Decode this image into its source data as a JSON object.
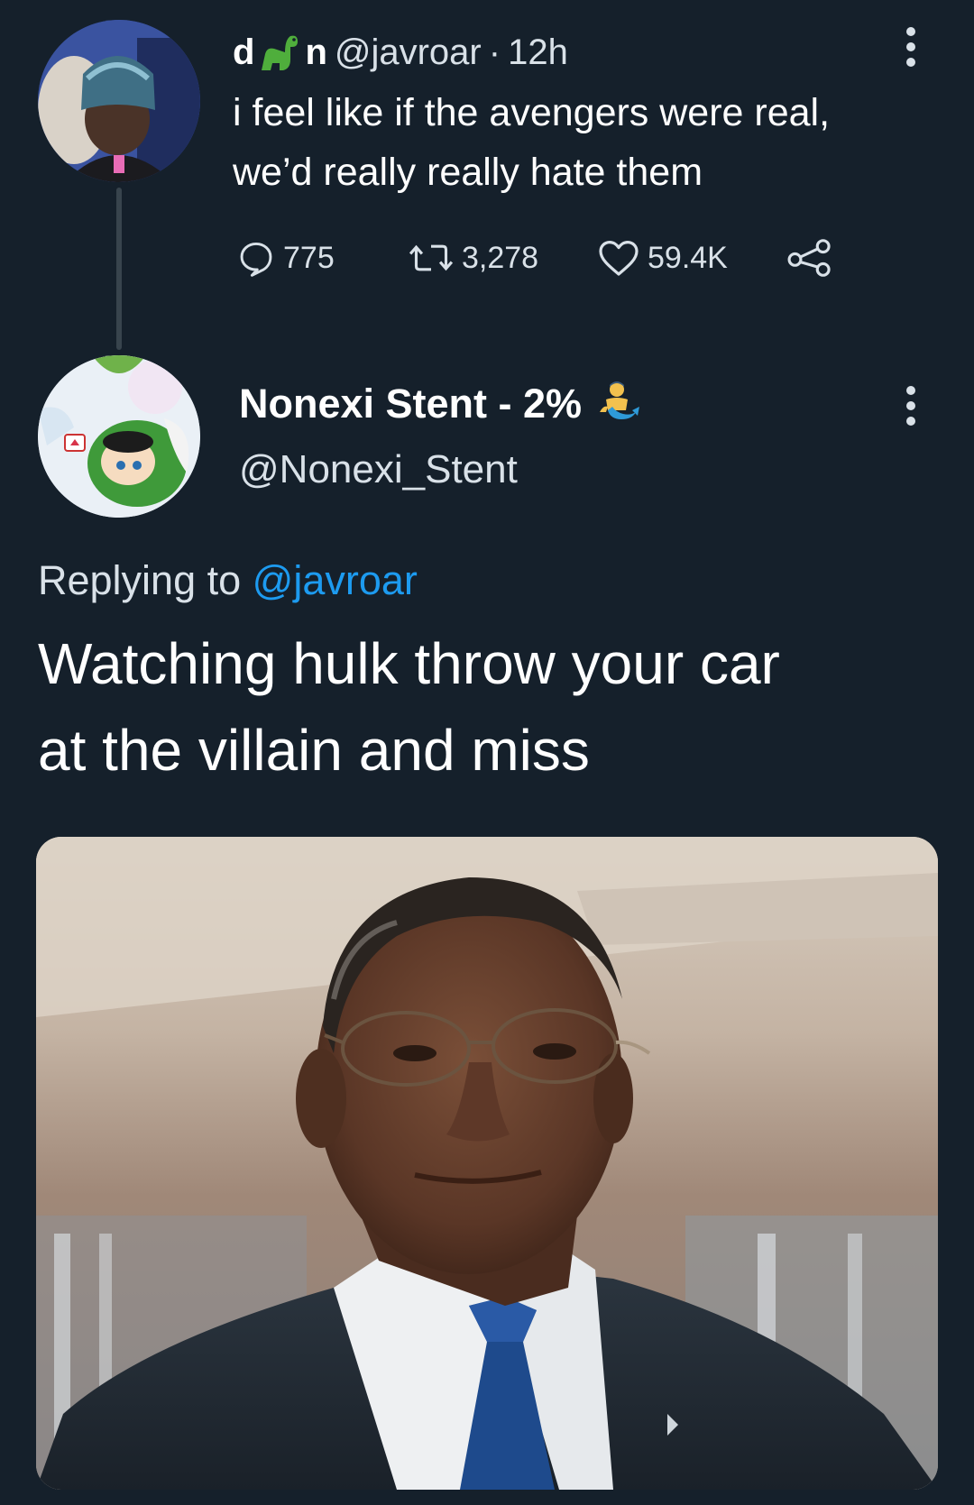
{
  "tweet1": {
    "display_name_start": "d",
    "display_name_emoji": "dinosaur-emoji",
    "display_name_end": "n",
    "handle": "@javroar",
    "separator": "·",
    "time": "12h",
    "text_line1": "i feel like if the avengers were real,",
    "text_line2": "we’d really really hate them",
    "replies": "775",
    "retweets": "3,278",
    "likes": "59.4K"
  },
  "tweet2": {
    "display_name": "Nonexi Stent - 2%",
    "display_name_emoji": "merman-emoji",
    "handle": "@Nonexi_Stent",
    "replying_prefix": "Replying to",
    "replying_handle": "@javroar",
    "text_line1": "Watching hulk throw your car",
    "text_line2": "at the villain and miss"
  },
  "colors": {
    "background": "#15202b",
    "text_primary": "#ffffff",
    "text_secondary": "#d9e1e8",
    "accent": "#1d9bf0",
    "divider": "#38444d"
  },
  "icons": {
    "reply": "reply-icon",
    "retweet": "retweet-icon",
    "like": "heart-icon",
    "share": "share-icon",
    "more": "more-options-icon"
  }
}
